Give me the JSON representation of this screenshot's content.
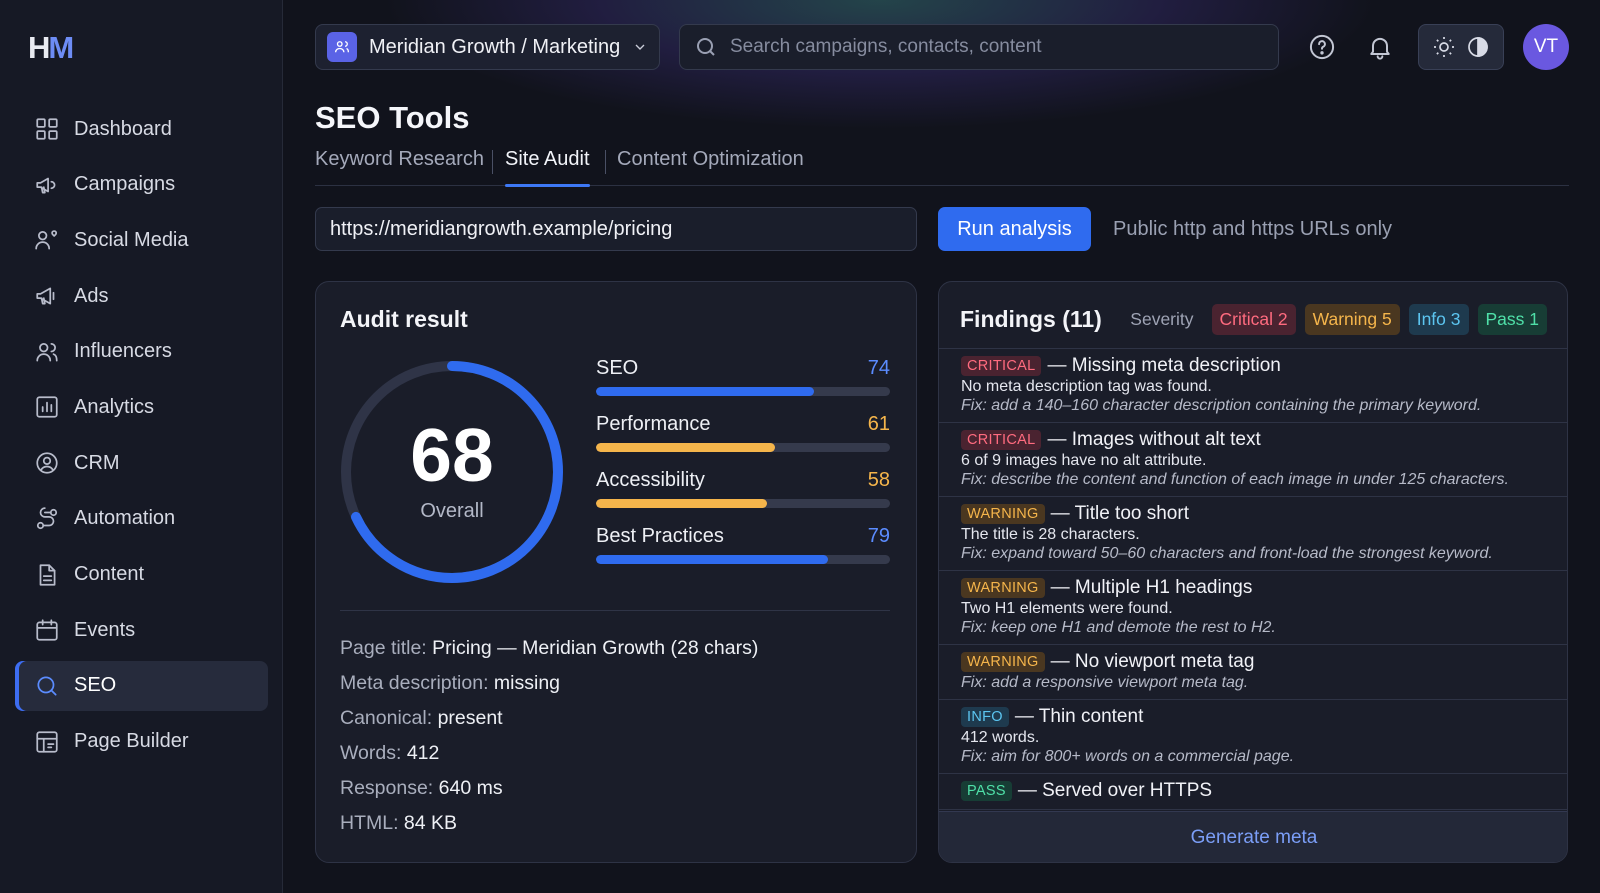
{
  "app": {
    "logo_h": "H",
    "logo_m": "M"
  },
  "sidebar": {
    "items": [
      {
        "label": "Dashboard",
        "icon": "grid-icon"
      },
      {
        "label": "Campaigns",
        "icon": "megaphone-icon"
      },
      {
        "label": "Social Media",
        "icon": "users-heart-icon"
      },
      {
        "label": "Ads",
        "icon": "megaphone-icon"
      },
      {
        "label": "Influencers",
        "icon": "users-icon"
      },
      {
        "label": "Analytics",
        "icon": "bar-chart-icon"
      },
      {
        "label": "CRM",
        "icon": "crm-icon"
      },
      {
        "label": "Automation",
        "icon": "automation-icon"
      },
      {
        "label": "Content",
        "icon": "document-icon"
      },
      {
        "label": "Events",
        "icon": "calendar-icon"
      },
      {
        "label": "SEO",
        "icon": "search-icon",
        "active": true
      },
      {
        "label": "Page Builder",
        "icon": "layout-icon"
      }
    ]
  },
  "topbar": {
    "workspace": "Meridian Growth / Marketing",
    "search_placeholder": "Search campaigns, contacts, content",
    "avatar": "VT"
  },
  "page": {
    "title": "SEO Tools",
    "tabs": [
      {
        "label": "Keyword Research"
      },
      {
        "label": "Site Audit",
        "active": true
      },
      {
        "label": "Content Optimization"
      }
    ]
  },
  "audit_form": {
    "url": "https://meridiangrowth.example/pricing",
    "run_label": "Run analysis",
    "hint": "Public http and https URLs only"
  },
  "audit": {
    "title": "Audit result",
    "overall_score": "68",
    "overall_label": "Overall",
    "overall_fraction": 0.68,
    "metrics": [
      {
        "name": "SEO",
        "value": "74",
        "score": 74,
        "color": "#2f6bef"
      },
      {
        "name": "Performance",
        "value": "61",
        "score": 61,
        "color": "#f5b54b"
      },
      {
        "name": "Accessibility",
        "value": "58",
        "score": 58,
        "color": "#f5b54b"
      },
      {
        "name": "Best Practices",
        "value": "79",
        "score": 79,
        "color": "#2f6bef"
      }
    ],
    "facts": [
      {
        "label": "Page title: ",
        "value": "Pricing — Meridian Growth (28 chars)"
      },
      {
        "label": "Meta description: ",
        "value": "missing"
      },
      {
        "label": "Canonical: ",
        "value": "present"
      },
      {
        "label": "Words: ",
        "value": "412"
      },
      {
        "label": "Response: ",
        "value": "640 ms"
      },
      {
        "label": "HTML: ",
        "value": "84 KB"
      }
    ]
  },
  "findings": {
    "title": "Findings (11)",
    "severity_label": "Severity",
    "chips": {
      "critical": "Critical 2",
      "warning": "Warning 5",
      "info": "Info 3",
      "pass": "Pass 1"
    },
    "items": [
      {
        "badge": "CRITICAL",
        "type": "crit",
        "title": "— Missing meta description",
        "detail": "No meta description tag was found.",
        "fix": "Fix: add a 140–160 character description containing the primary keyword."
      },
      {
        "badge": "CRITICAL",
        "type": "crit",
        "title": "— Images without alt text",
        "detail": "6 of 9 images have no alt attribute.",
        "fix": "Fix: describe the content and function of each image in under 125 characters."
      },
      {
        "badge": "WARNING",
        "type": "warn",
        "title": "— Title too short",
        "detail": "The title is 28 characters.",
        "fix": "Fix: expand toward 50–60 characters and front-load the strongest keyword."
      },
      {
        "badge": "WARNING",
        "type": "warn",
        "title": "— Multiple H1 headings",
        "detail": "Two H1 elements were found.",
        "fix": "Fix: keep one H1 and demote the rest to H2."
      },
      {
        "badge": "WARNING",
        "type": "warn",
        "title": "— No viewport meta tag",
        "detail": "",
        "fix": "Fix: add a responsive viewport meta tag."
      },
      {
        "badge": "INFO",
        "type": "info",
        "title": "— Thin content",
        "detail": "412 words.",
        "fix": "Fix: aim for 800+ words on a commercial page."
      },
      {
        "badge": "PASS",
        "type": "pass",
        "title": "— Served over HTTPS",
        "detail": "",
        "fix": ""
      }
    ],
    "generate_label": "Generate meta"
  },
  "colors": {
    "accent": "#2f6bef",
    "critical": "#ff6b7f",
    "warning": "#f5b54b",
    "info": "#5cc5f0",
    "pass": "#4fe0a8"
  }
}
